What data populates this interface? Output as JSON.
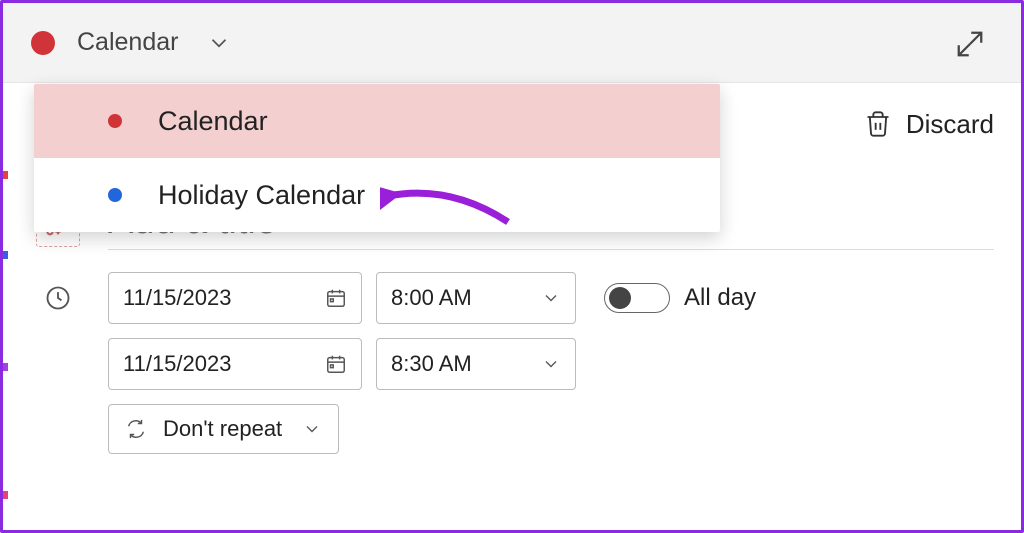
{
  "header": {
    "calendar_color": "#d13438",
    "selected_label": "Calendar"
  },
  "dropdown": {
    "items": [
      {
        "label": "Calendar",
        "color": "#d13438",
        "selected": true
      },
      {
        "label": "Holiday Calendar",
        "color": "#2266dd",
        "selected": false
      }
    ]
  },
  "toolbar": {
    "discard_label": "Discard"
  },
  "event": {
    "title_placeholder": "Add a title",
    "start_date": "11/15/2023",
    "start_time": "8:00 AM",
    "end_date": "11/15/2023",
    "end_time": "8:30 AM",
    "allday_label": "All day",
    "allday_on": false,
    "repeat_label": "Don't repeat"
  },
  "annotation": {
    "arrow_color": "#9a1fd8"
  }
}
